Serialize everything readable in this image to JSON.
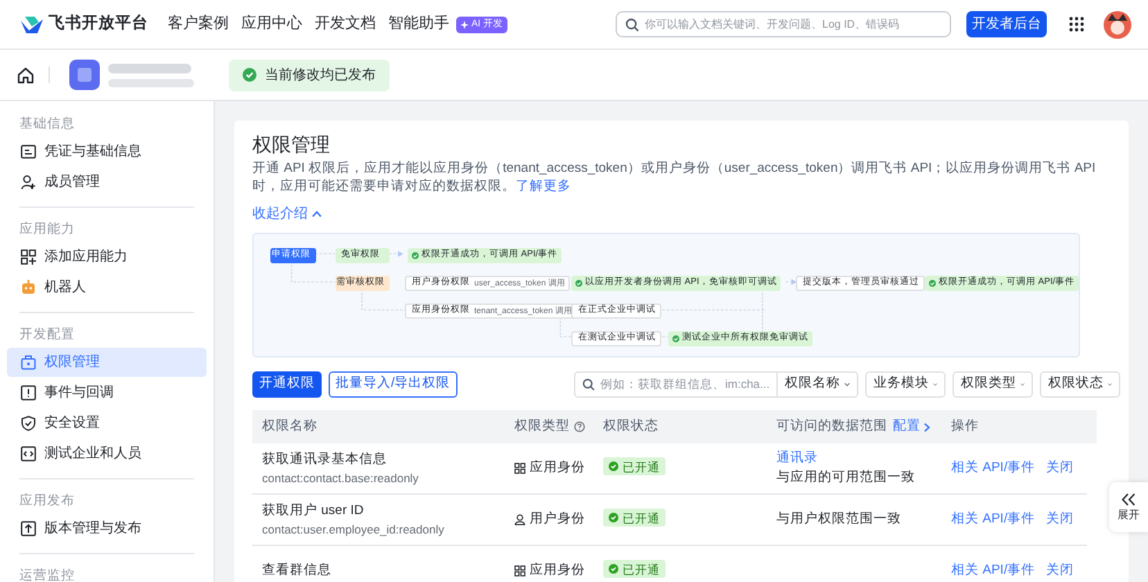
{
  "header": {
    "logo": "飞书开放平台",
    "nav": [
      {
        "label": "客户案例"
      },
      {
        "label": "应用中心"
      },
      {
        "label": "开发文档"
      },
      {
        "label": "智能助手",
        "badge": "AI 开发"
      }
    ],
    "search": {
      "placeholder": "你可以输入文档关键词、开发问题、Log ID、错误码"
    },
    "console_button": "开发者后台"
  },
  "app_bar": {
    "status": "当前修改均已发布"
  },
  "sidebar": {
    "sections": [
      {
        "title": "基础信息",
        "items": [
          {
            "label": "凭证与基础信息",
            "selected": false
          },
          {
            "label": "成员管理",
            "selected": false
          }
        ]
      },
      {
        "title": "应用能力",
        "items": [
          {
            "label": "添加应用能力",
            "selected": false
          },
          {
            "label": "机器人",
            "selected": false
          }
        ]
      },
      {
        "title": "开发配置",
        "items": [
          {
            "label": "权限管理",
            "selected": true
          },
          {
            "label": "事件与回调",
            "selected": false
          },
          {
            "label": "安全设置",
            "selected": false
          },
          {
            "label": "测试企业和人员",
            "selected": false
          }
        ]
      },
      {
        "title": "应用发布",
        "items": [
          {
            "label": "版本管理与发布",
            "selected": false
          }
        ]
      },
      {
        "title": "运营监控"
      }
    ]
  },
  "page": {
    "title": "权限管理",
    "intro": "开通 API 权限后，应用才能以应用身份（tenant_access_token）或用户身份（user_access_token）调用飞书 API；以应用身份调用飞书 API 时，应用可能还需要申请对应的数据权限。",
    "learn_more": "了解更多",
    "collapse": "收起介绍"
  },
  "diagram": {
    "nodes": [
      {
        "kind": "primary",
        "label": "申请权限"
      },
      {
        "kind": "tag_green",
        "label": "免审权限"
      },
      {
        "kind": "success",
        "label": "权限开通成功，可调用 API/事件"
      },
      {
        "kind": "tag_orange",
        "label": "需审核权限"
      },
      {
        "kind": "plain",
        "label": "用户身份权限",
        "note": "user_access_token 调用"
      },
      {
        "kind": "success",
        "label": "以应用开发者身份调用 API，免审核即可调试"
      },
      {
        "kind": "plain",
        "label": "提交版本，管理员审核通过"
      },
      {
        "kind": "success",
        "label": "权限开通成功，可调用 API/事件"
      },
      {
        "kind": "plain",
        "label": "应用身份权限",
        "note": "tenant_access_token 调用"
      },
      {
        "kind": "plain",
        "label": "在正式企业中调试"
      },
      {
        "kind": "plain",
        "label": "在测试企业中调试"
      },
      {
        "kind": "success",
        "label": "测试企业中所有权限免审调试"
      }
    ]
  },
  "toolbar": {
    "primary_button": "开通权限",
    "secondary_button": "批量导入/导出权限",
    "search": {
      "placeholder": "例如：获取群组信息、im:cha..."
    },
    "search_scope": "权限名称",
    "filters": [
      "业务模块",
      "权限类型",
      "权限状态"
    ]
  },
  "table": {
    "columns": [
      "权限名称",
      "权限类型",
      "权限状态",
      "可访问的数据范围",
      "操作"
    ],
    "config_link": "配置",
    "rows": [
      {
        "name": "获取通讯录基本信息",
        "scope": "contact:contact.base:readonly",
        "type": {
          "kind": "app",
          "label": "应用身份"
        },
        "status": "已开通",
        "range_link": "通讯录",
        "range": "与应用的可用范围一致",
        "actions": [
          "相关 API/事件",
          "关闭"
        ]
      },
      {
        "name": "获取用户 user ID",
        "scope": "contact:user.employee_id:readonly",
        "type": {
          "kind": "user",
          "label": "用户身份"
        },
        "status": "已开通",
        "range": "与用户权限范围一致",
        "actions": [
          "相关 API/事件",
          "关闭"
        ]
      },
      {
        "name": "查看群信息",
        "type": {
          "kind": "app",
          "label": "应用身份"
        },
        "status": "已开通",
        "actions": [
          "相关 API/事件",
          "关闭"
        ]
      }
    ]
  },
  "expand_button": "展开"
}
